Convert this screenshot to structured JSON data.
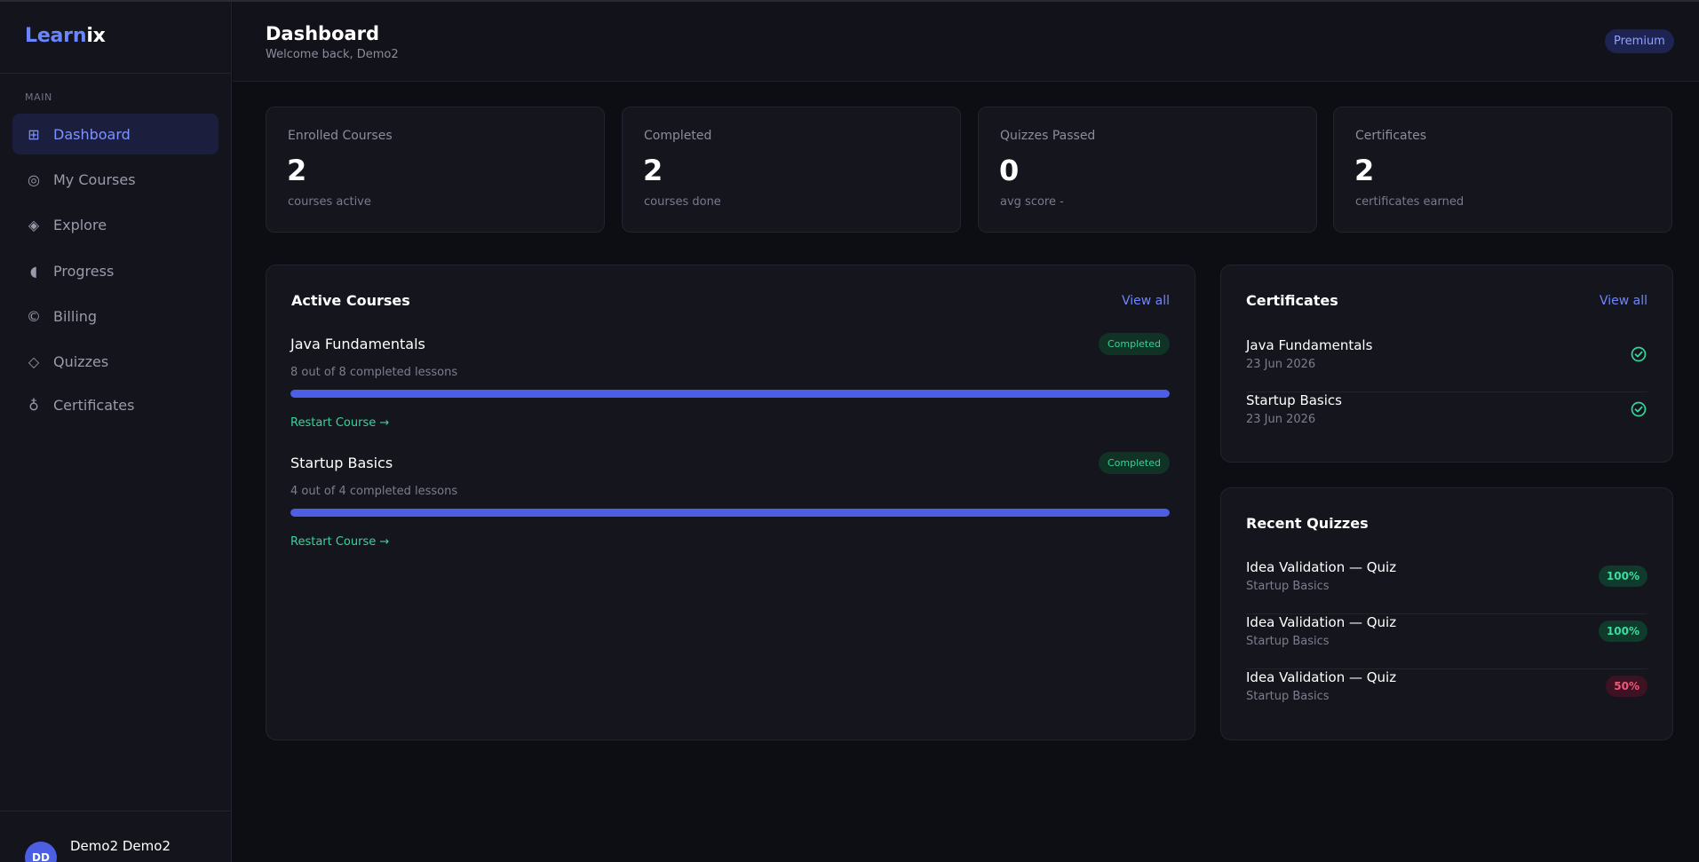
{
  "brand": {
    "part1": "Learn",
    "part2": "ix"
  },
  "sidebar": {
    "section_label": "MAIN",
    "items": [
      {
        "label": "Dashboard",
        "icon": "grid-icon",
        "glyph": "⊞",
        "active": true
      },
      {
        "label": "My Courses",
        "icon": "target-icon",
        "glyph": "◎",
        "active": false
      },
      {
        "label": "Explore",
        "icon": "compass-icon",
        "glyph": "◈",
        "active": false
      },
      {
        "label": "Progress",
        "icon": "progress-icon",
        "glyph": "◖",
        "active": false
      },
      {
        "label": "Billing",
        "icon": "billing-icon",
        "glyph": "©",
        "active": false
      },
      {
        "label": "Quizzes",
        "icon": "diamond-icon",
        "glyph": "◇",
        "active": false
      },
      {
        "label": "Certificates",
        "icon": "award-icon",
        "glyph": "♁",
        "active": false
      }
    ]
  },
  "user": {
    "initials": "DD",
    "name": "Demo2 Demo2"
  },
  "header": {
    "title": "Dashboard",
    "subtitle": "Welcome back, Demo2",
    "badge": "Premium"
  },
  "stats": [
    {
      "label": "Enrolled Courses",
      "value": "2",
      "sub": "courses active"
    },
    {
      "label": "Completed",
      "value": "2",
      "sub": "courses done"
    },
    {
      "label": "Quizzes Passed",
      "value": "0",
      "sub": "avg score -"
    },
    {
      "label": "Certificates",
      "value": "2",
      "sub": "certificates earned"
    }
  ],
  "active_courses": {
    "title": "Active Courses",
    "view_all": "View all",
    "courses": [
      {
        "name": "Java Fundamentals",
        "status": "Completed",
        "lessons": "8 out of 8 completed lessons",
        "progress": 1.0,
        "action": "Restart Course →"
      },
      {
        "name": "Startup Basics",
        "status": "Completed",
        "lessons": "4 out of 4 completed lessons",
        "progress": 1.0,
        "action": "Restart Course →"
      }
    ]
  },
  "certificates": {
    "title": "Certificates",
    "view_all": "View all",
    "items": [
      {
        "name": "Java Fundamentals",
        "date": "23 Jun 2026"
      },
      {
        "name": "Startup Basics",
        "date": "23 Jun 2026"
      }
    ]
  },
  "recent_quizzes": {
    "title": "Recent Quizzes",
    "items": [
      {
        "name": "Idea Validation — Quiz",
        "course": "Startup Basics",
        "score": "100%",
        "pass": true
      },
      {
        "name": "Idea Validation — Quiz",
        "course": "Startup Basics",
        "score": "100%",
        "pass": true
      },
      {
        "name": "Idea Validation — Quiz",
        "course": "Startup Basics",
        "score": "50%",
        "pass": false
      }
    ]
  },
  "colors": {
    "accent": "#6a86ff",
    "pass_bg": "#0f3a2c",
    "pass_fg": "#3ddc9f",
    "fail_bg": "#3d1222",
    "fail_fg": "#f0577a"
  }
}
